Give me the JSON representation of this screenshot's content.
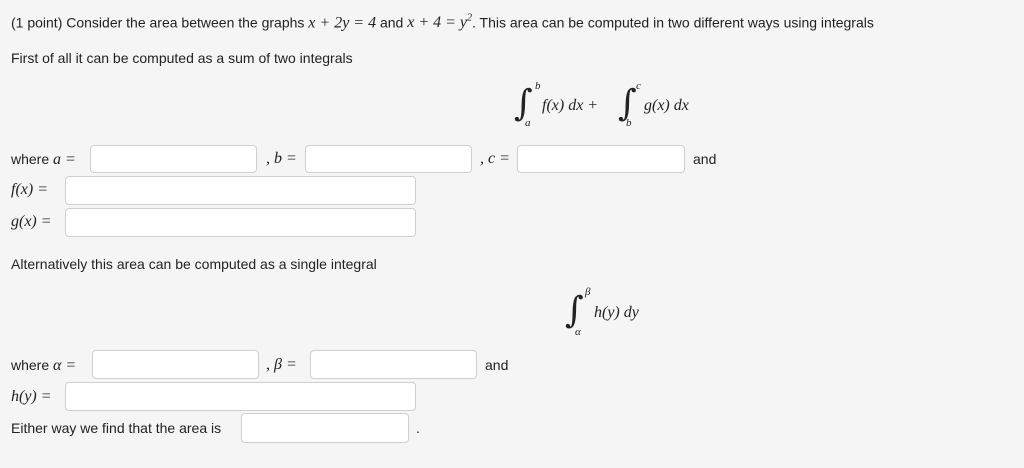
{
  "problem": {
    "prefix": "(1 point) Consider the area between the graphs",
    "eq1": "x + 2y = 4",
    "and": "and",
    "eq2_left": "x + 4 = y",
    "eq2_exp": "2",
    "suffix": ". This area can be computed in two different ways using integrals"
  },
  "part1": {
    "intro": "First of all it can be computed as a sum of two integrals",
    "integral": {
      "upper1": "b",
      "lower1": "a",
      "integrand1": "f(x) dx +",
      "upper2": "c",
      "lower2": "b",
      "integrand2": "g(x) dx"
    },
    "where": "where",
    "a_label": "a =",
    "b_label": ", b =",
    "c_label": ", c =",
    "and": "and",
    "f_label": "f(x) =",
    "g_label": "g(x) =",
    "a_value": "",
    "b_value": "",
    "c_value": "",
    "f_value": "",
    "g_value": ""
  },
  "part2": {
    "intro": "Alternatively this area can be computed as a single integral",
    "integral": {
      "upper": "β",
      "lower": "α",
      "integrand": "h(y) dy"
    },
    "where": "where",
    "alpha_label": "α =",
    "beta_label": ", β =",
    "and": "and",
    "h_label": "h(y) =",
    "alpha_value": "",
    "beta_value": "",
    "h_value": ""
  },
  "final": {
    "text": "Either way we find that the area is",
    "period": ".",
    "area_value": ""
  }
}
